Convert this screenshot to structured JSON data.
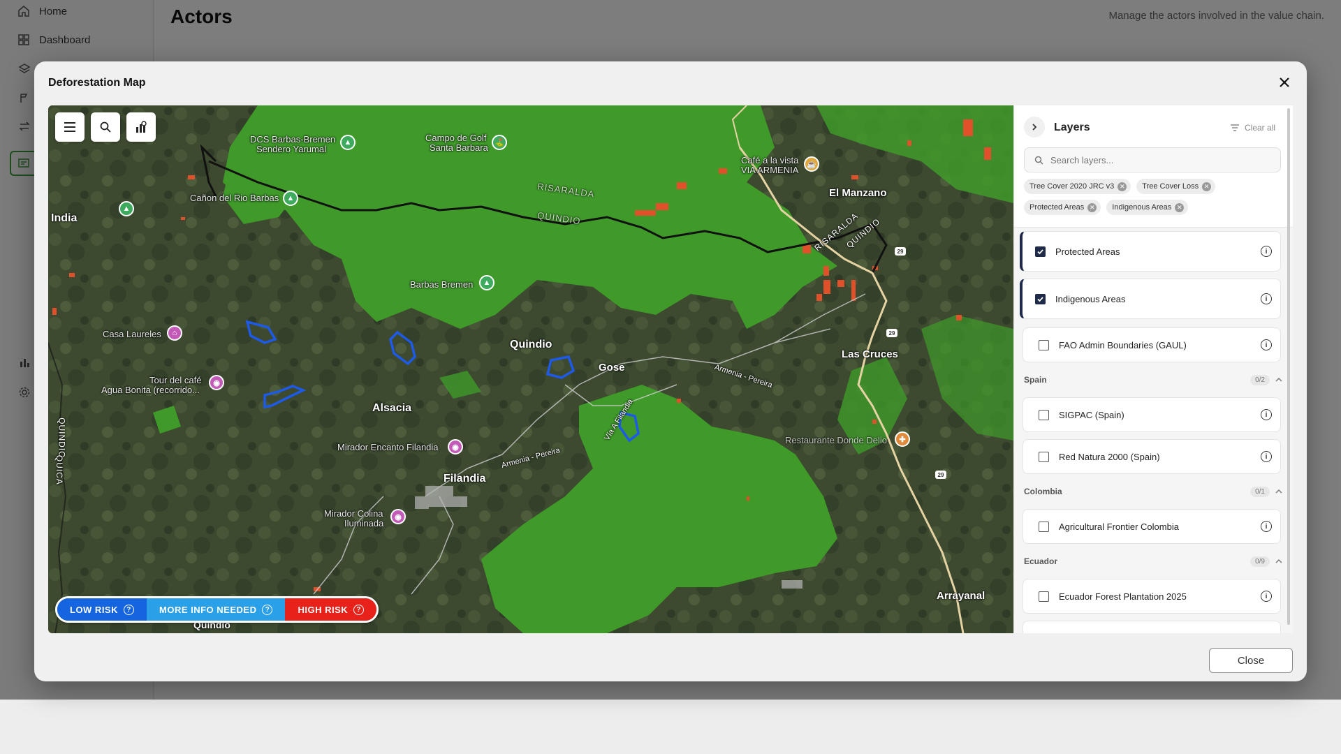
{
  "app": {
    "nav": [
      {
        "label": "Home",
        "icon": "home-icon"
      },
      {
        "label": "Dashboard",
        "icon": "dashboard-icon"
      }
    ],
    "page_title": "Actors",
    "page_subtitle": "Manage the actors involved in the value chain."
  },
  "modal": {
    "title": "Deforestation Map",
    "close_label": "Close"
  },
  "map": {
    "places": {
      "india": "India",
      "canon": "Cañon del Rio Barbas",
      "dcs1": "DCS Barbas-Bremen",
      "dcs2": "Sendero Yarumal",
      "campo1": "Campo de Golf",
      "campo2": "Santa Barbara",
      "cafe1": "Café a la vista",
      "cafe2": "VIA ARMENIA",
      "manzano": "El Manzano",
      "barbas": "Barbas Bremen",
      "quindio": "Quindio",
      "gose": "Gose",
      "lascruces": "Las Cruces",
      "casa": "Casa Laureles",
      "tour1": "Tour del café",
      "tour2": "Agua Bonita (recorrido...",
      "alsacia": "Alsacia",
      "mirador_enc": "Mirador Encanto Filandia",
      "filandia": "Filandia",
      "mirador_col1": "Mirador Colina",
      "mirador_col2": "Iluminada",
      "restaurante": "Restaurante Donde Delio",
      "arrayanal": "Arrayanal",
      "quindio_bottom": "Quindio",
      "river_risaralda": "RISARALDA",
      "river_quindio": "QUINDIO",
      "dept_risaralda": "RISARALDA",
      "dept_quindio": "QUINDIO",
      "left_vertical": "QUINDIO",
      "left_vertical2": "QUICA",
      "road_armenia": "Armenia - Pereira",
      "road_armenia2": "Armenia - Pereira",
      "road_via": "Vía A Filandia",
      "route_29a": "29",
      "route_29b": "29",
      "route_29c": "29"
    },
    "legend": [
      {
        "label": "LOW RISK",
        "color": "#1565e0"
      },
      {
        "label": "MORE INFO NEEDED",
        "color": "#2aa0e8"
      },
      {
        "label": "HIGH RISK",
        "color": "#e8221b"
      }
    ],
    "colors": {
      "tree_cover": "#3f9a2a",
      "tree_loss": "#e0502a",
      "protected": "#1e5ae8"
    }
  },
  "layers": {
    "title": "Layers",
    "clear_all": "Clear all",
    "search_placeholder": "Search layers...",
    "chips": [
      "Tree Cover 2020 JRC v3",
      "Tree Cover Loss",
      "Protected Areas",
      "Indigenous Areas"
    ],
    "active": [
      {
        "label": "Protected Areas",
        "checked": true
      },
      {
        "label": "Indigenous Areas",
        "checked": true
      },
      {
        "label": "FAO Admin Boundaries (GAUL)",
        "checked": false
      }
    ],
    "groups": [
      {
        "name": "Spain",
        "count": "0/2",
        "items": [
          "SIGPAC (Spain)",
          "Red Natura 2000 (Spain)"
        ]
      },
      {
        "name": "Colombia",
        "count": "0/1",
        "items": [
          "Agricultural Frontier Colombia"
        ]
      },
      {
        "name": "Ecuador",
        "count": "0/9",
        "items": [
          "Ecuador Forest Plantation 2025"
        ]
      }
    ]
  }
}
